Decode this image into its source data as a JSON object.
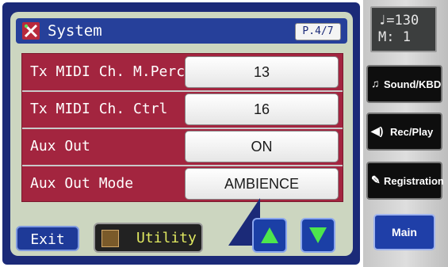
{
  "window": {
    "title": "System",
    "page": "P.4/7",
    "title_icon": "system-tools-icon"
  },
  "parameters": [
    {
      "label": "Tx MIDI Ch. M.Perc",
      "value": "13"
    },
    {
      "label": "Tx MIDI Ch. Ctrl",
      "value": "16"
    },
    {
      "label": "Aux Out",
      "value": "ON"
    },
    {
      "label": "Aux Out Mode",
      "value": "AMBIENCE"
    }
  ],
  "footer": {
    "exit_label": "Exit",
    "utility_label": "Utility",
    "up_icon": "arrow-up-icon",
    "down_icon": "arrow-down-icon"
  },
  "status": {
    "tempo": "♩=130",
    "measure": "M:   1"
  },
  "side_buttons": [
    {
      "label": "Sound/KBD",
      "icon": "music-note-icon"
    },
    {
      "label": "Rec/Play",
      "icon": "speaker-icon"
    },
    {
      "label": "Registration",
      "icon": "registration-icon"
    }
  ],
  "main_label": "Main",
  "colors": {
    "frame": "#1b2a78",
    "panel": "#ccd6c0",
    "row_bg": "#a3253f",
    "arrow": "#4de64d",
    "utility_text": "#e0e860"
  }
}
